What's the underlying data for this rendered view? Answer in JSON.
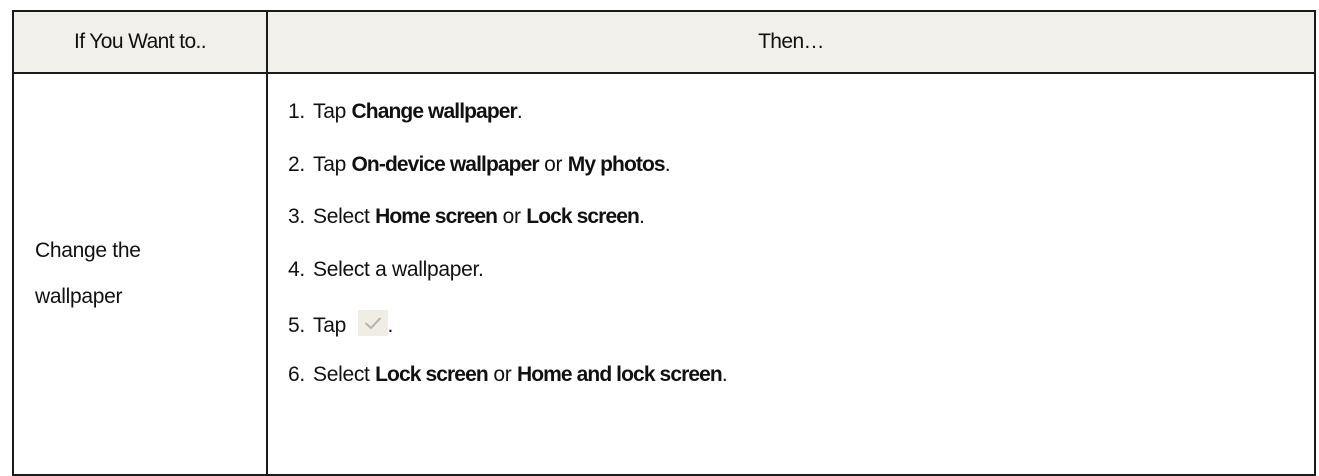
{
  "table": {
    "headers": [
      "If You Want to..",
      "Then…"
    ],
    "row": {
      "want_lines": [
        "Change the",
        "wallpaper"
      ],
      "steps": [
        {
          "num": "1.",
          "parts": [
            "Tap ",
            "Change wallpaper",
            "."
          ]
        },
        {
          "num": "2.",
          "parts": [
            "Tap ",
            "On-device wallpaper",
            " or ",
            "My photos",
            "."
          ]
        },
        {
          "num": "3.",
          "parts": [
            "Select ",
            "Home screen",
            " or ",
            "Lock screen",
            "."
          ]
        },
        {
          "num": "4.",
          "parts": [
            "Select a wallpaper."
          ]
        },
        {
          "num": "5.",
          "parts": [
            "Tap ",
            "."
          ],
          "icon": "checkmark-icon"
        },
        {
          "num": "6.",
          "parts": [
            "Select ",
            "Lock screen",
            " or ",
            "Home and lock screen",
            "."
          ]
        }
      ]
    }
  }
}
